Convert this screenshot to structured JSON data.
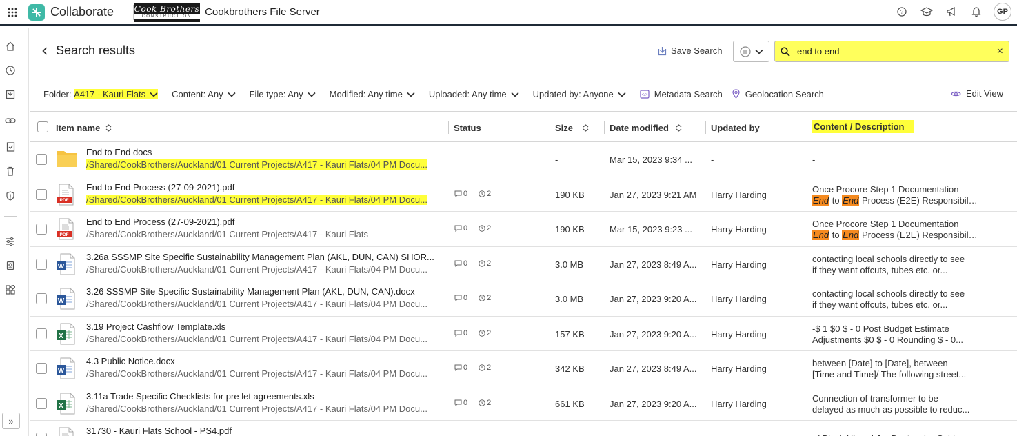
{
  "app": {
    "brand": "Collaborate",
    "client_logo_line1": "Cook Brothers",
    "client_logo_line2": "CONSTRUCTION",
    "project": "Cookbrothers File Server",
    "avatar": "GP",
    "top_icons": [
      "help-icon",
      "learn-icon",
      "announcements-icon",
      "notifications-icon"
    ]
  },
  "sidebar": {
    "items": [
      "home-icon",
      "recent-icon",
      "inbox-icon",
      "link-icon",
      "tasks-icon",
      "trash-icon",
      "shield-icon",
      "settings-sliders-icon",
      "badge-icon",
      "apps-icon"
    ],
    "expand": "»"
  },
  "header": {
    "title": "Search results",
    "save_search": "Save Search",
    "search_value": "end to end",
    "clear": "×"
  },
  "filters": {
    "folder_label": "Folder:",
    "folder_value": "A417 - Kauri Flats",
    "content": "Content: Any",
    "file_type": "File type: Any",
    "modified": "Modified: Any time",
    "uploaded": "Uploaded: Any time",
    "updated_by": "Updated by: Anyone",
    "metadata": "Metadata Search",
    "geolocation": "Geolocation Search",
    "edit_view": "Edit View"
  },
  "columns": {
    "name": "Item name",
    "status": "Status",
    "size": "Size",
    "date": "Date modified",
    "updated_by": "Updated by",
    "content": "Content / Description"
  },
  "rows": [
    {
      "type": "folder",
      "name": "End to End docs",
      "path": "/Shared/CookBrothers/Auckland/01 Current Projects/A417 - Kauri Flats/04 PM Docu...",
      "size": "-",
      "date": "Mar 15, 2023 9:34 ...",
      "updated_by": "-",
      "desc1": "-",
      "desc2": ""
    },
    {
      "type": "pdf",
      "name": "End to End Process (27-09-2021).pdf",
      "path": "/Shared/CookBrothers/Auckland/01 Current Projects/A417 - Kauri Flats/04 PM Docu...",
      "comments": "0",
      "versions": "2",
      "size": "190 KB",
      "date": "Jan 27, 2023 9:21 AM",
      "updated_by": "Harry Harding",
      "desc1": "Once Procore Step 1 Documentation",
      "desc2_pre": "",
      "desc2_m1": "End",
      "desc2_mid": " to ",
      "desc2_m2": "End",
      "desc2_post": " Process (E2E) Responsibili..."
    },
    {
      "type": "pdf",
      "name": "End to End Process (27-09-2021).pdf",
      "path": "/Shared/CookBrothers/Auckland/01 Current Projects/A417 - Kauri Flats",
      "comments": "0",
      "versions": "2",
      "size": "190 KB",
      "date": "Mar 15, 2023 9:23 ...",
      "updated_by": "Harry Harding",
      "desc1": "Once Procore Step 1 Documentation",
      "desc2_m1": "End",
      "desc2_mid": " to ",
      "desc2_m2": "End",
      "desc2_post": " Process (E2E) Responsibili..."
    },
    {
      "type": "word",
      "name": "3.26a SSSMP Site Specific Sustainability Management Plan (AKL, DUN, CAN) SHOR...",
      "path": "/Shared/CookBrothers/Auckland/01 Current Projects/A417 - Kauri Flats/04 PM Docu...",
      "comments": "0",
      "versions": "2",
      "size": "3.0 MB",
      "date": "Jan 27, 2023 8:49 A...",
      "updated_by": "Harry Harding",
      "desc1": "contacting local schools directly to see",
      "desc2": "if they want offcuts, tubes etc. or..."
    },
    {
      "type": "word",
      "name": "3.26 SSSMP Site Specific Sustainability Management Plan (AKL, DUN, CAN).docx",
      "path": "/Shared/CookBrothers/Auckland/01 Current Projects/A417 - Kauri Flats/04 PM Docu...",
      "comments": "0",
      "versions": "2",
      "size": "3.0 MB",
      "date": "Jan 27, 2023 9:20 A...",
      "updated_by": "Harry Harding",
      "desc1": "contacting local schools directly to see",
      "desc2": "if they want offcuts, tubes etc. or..."
    },
    {
      "type": "excel",
      "name": "3.19 Project Cashflow Template.xls",
      "path": "/Shared/CookBrothers/Auckland/01 Current Projects/A417 - Kauri Flats/04 PM Docu...",
      "comments": "0",
      "versions": "2",
      "size": "157 KB",
      "date": "Jan 27, 2023 9:20 A...",
      "updated_by": "Harry Harding",
      "desc1": "-$ 1 $0 $ - 0 Post Budget Estimate",
      "desc2": "Adjustments $0 $ - 0 Rounding $ - 0..."
    },
    {
      "type": "word",
      "name": "4.3 Public Notice.docx",
      "path": "/Shared/CookBrothers/Auckland/01 Current Projects/A417 - Kauri Flats/04 PM Docu...",
      "comments": "0",
      "versions": "2",
      "size": "342 KB",
      "date": "Jan 27, 2023 8:49 A...",
      "updated_by": "Harry Harding",
      "desc1": "between [Date] to [Date], between",
      "desc2": "[Time and Time]/ The following street..."
    },
    {
      "type": "excel",
      "name": "3.11a Trade Specific Checklists for pre let agreements.xls",
      "path": "/Shared/CookBrothers/Auckland/01 Current Projects/A417 - Kauri Flats/04 PM Docu...",
      "comments": "0",
      "versions": "2",
      "size": "661 KB",
      "date": "Jan 27, 2023 9:20 A...",
      "updated_by": "Harry Harding",
      "desc1": "Connection of transformer to be",
      "desc2": "delayed as much as possible to reduc..."
    },
    {
      "type": "pdf",
      "name": "31730 - Kauri Flats School - PS4.pdf",
      "path": "",
      "comments": "",
      "versions": "",
      "size": "",
      "date": "",
      "updated_by": "",
      "desc1": "of Block H) and J: • Ductwork • Cable",
      "desc2": ""
    }
  ],
  "colors": {
    "highlight": "#ffff3a",
    "match": "#f58a1f",
    "brand": "#3fb9a6",
    "pdf": "#d93025",
    "word": "#2b579a",
    "excel": "#217346",
    "folder": "#f6c342"
  }
}
